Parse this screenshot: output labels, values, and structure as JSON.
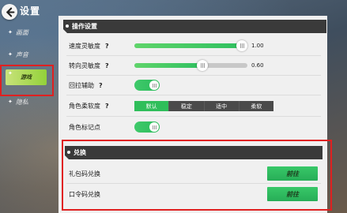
{
  "header": {
    "title": "设置",
    "back_icon": "back-arrow-icon"
  },
  "sidebar": {
    "items": [
      {
        "label": "画面",
        "active": false
      },
      {
        "label": "声音",
        "active": false
      },
      {
        "label": "游戏",
        "active": true
      },
      {
        "label": "隐私",
        "active": false
      }
    ]
  },
  "operation": {
    "title": "操作设置",
    "speed_sensitivity": {
      "label": "速度灵敏度",
      "help": "?",
      "value": "1.00",
      "fraction": 0.95
    },
    "steer_sensitivity": {
      "label": "转向灵敏度",
      "help": "?",
      "value": "0.60",
      "fraction": 0.6
    },
    "return_assist": {
      "label": "回拉辅助",
      "help": "?",
      "on": true
    },
    "character_softness": {
      "label": "角色柔软度",
      "help": "?",
      "options": [
        "默认",
        "稳定",
        "适中",
        "柔软"
      ],
      "selected": "默认"
    },
    "character_marker": {
      "label": "角色标记点",
      "on": true
    }
  },
  "redeem": {
    "title": "兑换",
    "gift_code": {
      "label": "礼包码兑换",
      "button": "前往"
    },
    "password": {
      "label": "口令码兑换",
      "button": "前往"
    }
  },
  "colors": {
    "accent_green": "#2fbe5a",
    "highlight_red": "#e02020",
    "sidebar_active": "#93d23a"
  }
}
